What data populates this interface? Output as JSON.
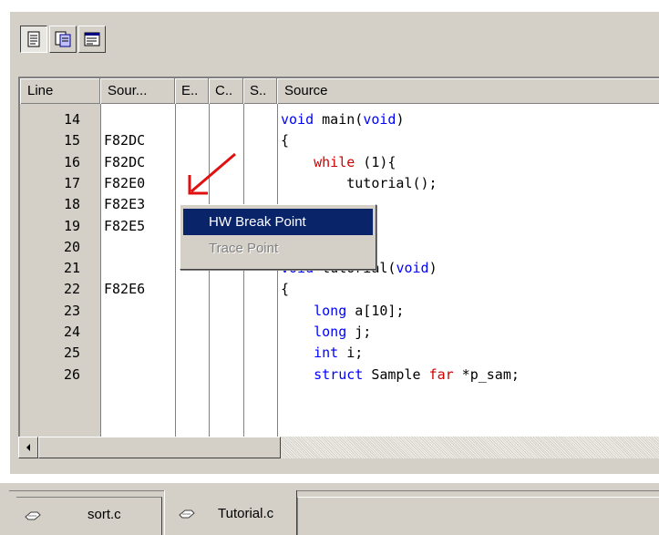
{
  "toolbar": {
    "buttons": [
      {
        "name": "source-view-icon",
        "pressed": true
      },
      {
        "name": "mixed-view-icon",
        "pressed": false
      },
      {
        "name": "disassembly-view-icon",
        "pressed": false
      }
    ]
  },
  "columns": {
    "line": "Line",
    "address": "Sour...",
    "event": "E..",
    "coverage": "C..",
    "s": "S..",
    "source": "Source"
  },
  "rows": [
    {
      "line": "14",
      "address": "",
      "code": [
        {
          "t": "void",
          "c": "kw"
        },
        {
          "t": " main(",
          "c": ""
        },
        {
          "t": "void",
          "c": "kw"
        },
        {
          "t": ")",
          "c": ""
        }
      ]
    },
    {
      "line": "15",
      "address": "F82DC",
      "code": [
        {
          "t": "{",
          "c": ""
        }
      ]
    },
    {
      "line": "16",
      "address": "F82DC",
      "code": [
        {
          "t": "    ",
          "c": ""
        },
        {
          "t": "while",
          "c": "red"
        },
        {
          "t": " (1){",
          "c": ""
        }
      ]
    },
    {
      "line": "17",
      "address": "F82E0",
      "code": [
        {
          "t": "        tutorial();",
          "c": ""
        }
      ]
    },
    {
      "line": "18",
      "address": "F82E3",
      "code": []
    },
    {
      "line": "19",
      "address": "F82E5",
      "code": []
    },
    {
      "line": "20",
      "address": "",
      "code": []
    },
    {
      "line": "21",
      "address": "",
      "code": [
        {
          "t": "void",
          "c": "kw"
        },
        {
          "t": " tutorial(",
          "c": ""
        },
        {
          "t": "void",
          "c": "kw"
        },
        {
          "t": ")",
          "c": ""
        }
      ]
    },
    {
      "line": "22",
      "address": "F82E6",
      "code": [
        {
          "t": "{",
          "c": ""
        }
      ]
    },
    {
      "line": "23",
      "address": "",
      "code": [
        {
          "t": "    ",
          "c": ""
        },
        {
          "t": "long",
          "c": "kw"
        },
        {
          "t": " a[10];",
          "c": ""
        }
      ]
    },
    {
      "line": "24",
      "address": "",
      "code": [
        {
          "t": "    ",
          "c": ""
        },
        {
          "t": "long",
          "c": "kw"
        },
        {
          "t": " j;",
          "c": ""
        }
      ]
    },
    {
      "line": "25",
      "address": "",
      "code": [
        {
          "t": "    ",
          "c": ""
        },
        {
          "t": "int",
          "c": "kw"
        },
        {
          "t": " i;",
          "c": ""
        }
      ]
    },
    {
      "line": "26",
      "address": "",
      "code": [
        {
          "t": "    ",
          "c": ""
        },
        {
          "t": "struct",
          "c": "kw"
        },
        {
          "t": " Sample ",
          "c": ""
        },
        {
          "t": "far",
          "c": "red"
        },
        {
          "t": " *p_sam;",
          "c": ""
        }
      ]
    },
    {
      "line": "",
      "address": "",
      "code": []
    }
  ],
  "context_menu": {
    "items": [
      {
        "label": "HW Break Point",
        "highlighted": true,
        "disabled": false
      },
      {
        "label": "Trace Point",
        "highlighted": false,
        "disabled": true
      }
    ]
  },
  "tabs": [
    {
      "label": "sort.c",
      "active": false
    },
    {
      "label": "Tutorial.c",
      "active": true
    }
  ],
  "colors": {
    "keyword": "#0000ff",
    "keyword_alt": "#d00000",
    "menu_highlight": "#0a246a",
    "arrow": "#e01010"
  }
}
